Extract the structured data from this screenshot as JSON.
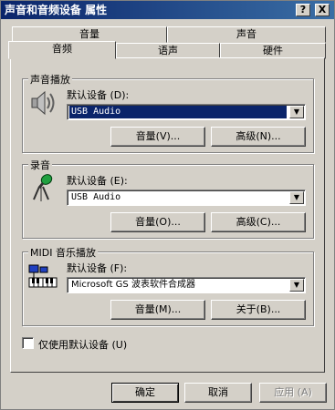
{
  "window": {
    "title": "声音和音频设备 属性",
    "help_button": "?",
    "close_button": "X"
  },
  "tabs": {
    "row_back": [
      "音量",
      "声音"
    ],
    "row_front": [
      "音频",
      "语声",
      "硬件"
    ],
    "active": "音频"
  },
  "playback": {
    "group_label": "声音播放",
    "device_label": "默认设备 (D):",
    "device_value": "USB Audio",
    "volume_button": "音量(V)...",
    "advanced_button": "高级(N)..."
  },
  "recording": {
    "group_label": "录音",
    "device_label": "默认设备 (E):",
    "device_value": "USB Audio",
    "volume_button": "音量(O)...",
    "advanced_button": "高级(C)..."
  },
  "midi": {
    "group_label": "MIDI 音乐播放",
    "device_label": "默认设备 (F):",
    "device_value": "Microsoft GS 波表软件合成器",
    "volume_button": "音量(M)...",
    "about_button": "关于(B)..."
  },
  "only_default_checkbox": {
    "label": "仅使用默认设备 (U)",
    "checked": false
  },
  "footer": {
    "ok": "确定",
    "cancel": "取消",
    "apply": "应用 (A)"
  }
}
